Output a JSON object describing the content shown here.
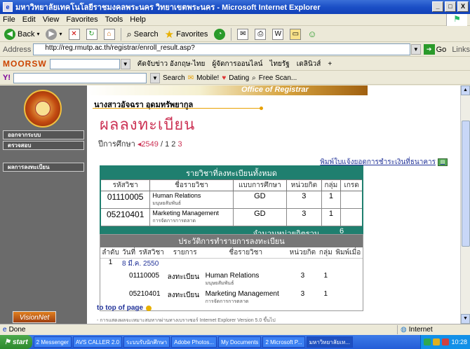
{
  "window": {
    "title": "มหาวิทยาลัยเทคโนโลยีราชมงคลพระนคร วิทยาเขตพระนคร - Microsoft Internet Explorer",
    "controls": [
      "_",
      "□",
      "X"
    ]
  },
  "menu": {
    "items": [
      "File",
      "Edit",
      "View",
      "Favorites",
      "Tools",
      "Help"
    ]
  },
  "toolbar": {
    "back": "Back",
    "search": "Search",
    "favorites": "Favorites"
  },
  "address": {
    "label": "Address",
    "url": "http://reg.rmutp.ac.th/registrar/enroll_result.asp?",
    "go": "Go",
    "links": "Links"
  },
  "moorsw": {
    "logo": "MOORSW",
    "links": [
      "คัดจับข่าว อังกฤษ-ไทย",
      "ผู้จัดการออนไลน์",
      "ไทยรัฐ",
      "เดลินิวส์"
    ]
  },
  "searchbar": {
    "search": "Search",
    "mobile": "Mobile!",
    "dating": "Dating",
    "free_scan": "Free Scan..."
  },
  "leftnav": {
    "items": [
      "ออกจากระบบ",
      "ตรวจสอบ",
      "ผลการลงทะเบียน"
    ],
    "vision": "VisionNet"
  },
  "page": {
    "banner": "Office of Registrar",
    "student_name": "นางสาวอัจฉรา อุดมทรัพยากูล",
    "title": "ผลลงทะเบียน",
    "year_label": "ปีการศึกษา",
    "year": "2549",
    "semesters": [
      "1",
      "2",
      "3"
    ],
    "pay_link": "พิมพ์ใบแจ้งยอดการชำระเงินที่ธนาคาร",
    "top_link": "to top of page",
    "footer": "- การแสดงผลจะเหมาะสมหากผ่านทางเบราเซอร์ Internet Explorer Version 5.0 ขึ้นไป"
  },
  "table1": {
    "heading": "รายวิชาที่ลงทะเบียนทั้งหมด",
    "columns": [
      "รหัสวิชา",
      "ชื่อรายวิชา",
      "แบบการศึกษา",
      "หน่วยกิต",
      "กลุ่ม",
      "เกรด"
    ],
    "rows": [
      {
        "code": "01110005",
        "name": "Human Relations",
        "name_th": "มนุษยสัมพันธ์",
        "type": "GD",
        "credits": "3",
        "group": "1",
        "grade": ""
      },
      {
        "code": "05210401",
        "name": "Marketing Management",
        "name_th": "การจัดการการตลาด",
        "type": "GD",
        "credits": "3",
        "group": "1",
        "grade": ""
      }
    ],
    "total_label": "จำนวนหน่วยกิตรวม",
    "total": "6"
  },
  "table2": {
    "heading": "ประวัติการทำรายการลงทะเบียน",
    "columns": [
      "ลำดับ",
      "วันที่",
      "รหัสวิชา",
      "รายการ",
      "ชื่อรายวิชา",
      "หน่วยกิต",
      "กลุ่ม",
      "พิมพ์เมื่อ"
    ],
    "entries": [
      {
        "no": "1",
        "date": "8 มี.ค. 2550",
        "items": [
          {
            "code": "01110005",
            "action": "ลงทะเบียน",
            "name": "Human Relations",
            "name_th": "มนุษยสัมพันธ์",
            "credits": "3",
            "group": "1"
          },
          {
            "code": "05210401",
            "action": "ลงทะเบียน",
            "name": "Marketing Management",
            "name_th": "การจัดการการตลาด",
            "credits": "3",
            "group": "1"
          }
        ]
      }
    ]
  },
  "status": {
    "text": "Done",
    "zone": "Internet"
  },
  "taskbar": {
    "start": "start",
    "tasks": [
      "2 Messenger",
      "AVS CALLER 2.0",
      "ระบบรับนักศึกษา",
      "Adobe Photos...",
      "My Documents",
      "2 Microsoft P...",
      "มหาวิทยาลัยเท..."
    ],
    "clock": "10:28"
  }
}
